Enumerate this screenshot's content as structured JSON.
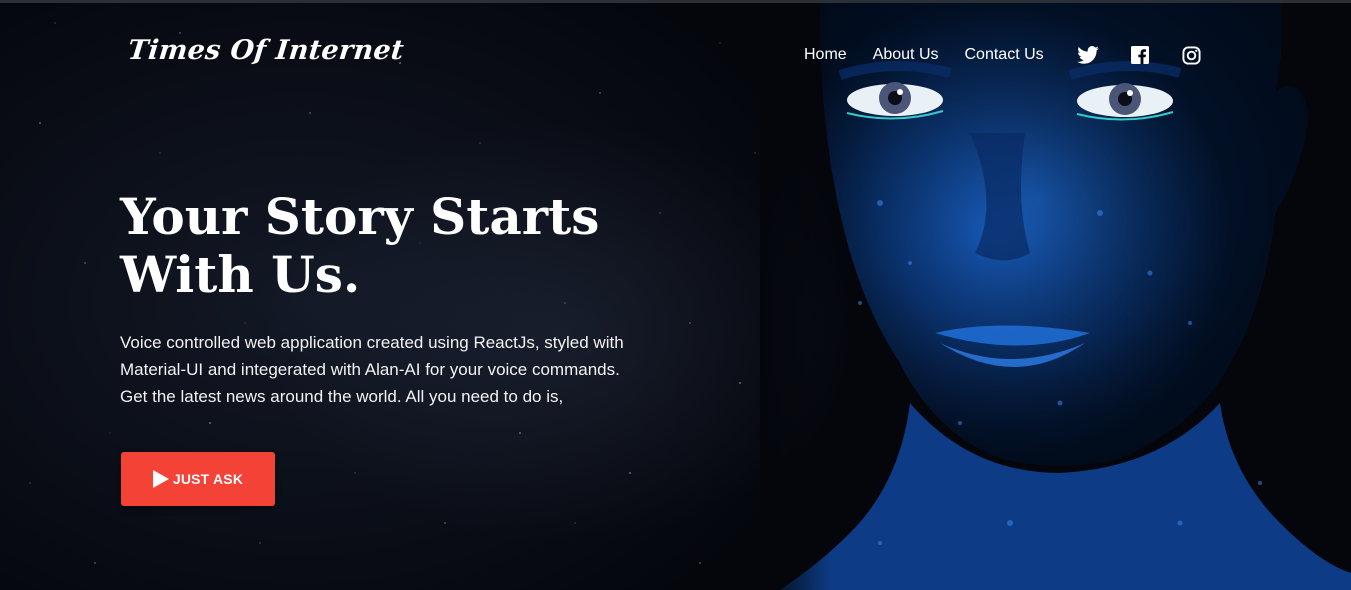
{
  "brand": {
    "logo_text": "Times Of Internet"
  },
  "nav": {
    "links": [
      "Home",
      "About Us",
      "Contact Us"
    ],
    "social_icons": [
      "twitter-icon",
      "facebook-icon",
      "instagram-icon"
    ]
  },
  "hero": {
    "headline_line1": "Your Story Starts",
    "headline_line2": "With Us.",
    "description_line1": "Voice controlled web application created using ReactJs, styled with",
    "description_line2": "Material-UI and integerated with Alan-AI for your voice commands.",
    "description_line3": "Get the latest news around the world. All you need to do is,",
    "cta_label": "JUST ASK",
    "cta_icon": "play-icon"
  },
  "colors": {
    "accent": "#f44336",
    "background": "#05070d",
    "face_blue": "#1556b5"
  }
}
